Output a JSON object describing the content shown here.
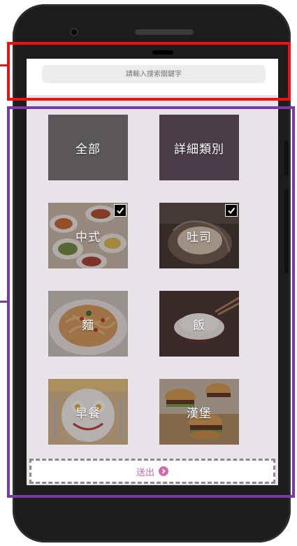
{
  "search": {
    "placeholder": "請輸入搜索關鍵字"
  },
  "categories": [
    {
      "label": "全部",
      "checked": false,
      "color": "#5a5759"
    },
    {
      "label": "詳細類別",
      "checked": false,
      "color": "#4a3d47"
    },
    {
      "label": "中式",
      "checked": true
    },
    {
      "label": "吐司",
      "checked": true
    },
    {
      "label": "麵",
      "checked": false
    },
    {
      "label": "飯",
      "checked": false
    },
    {
      "label": "早餐",
      "checked": false
    },
    {
      "label": "漢堡",
      "checked": false
    }
  ],
  "submit": {
    "label": "送出"
  },
  "colors": {
    "annotation_red": "#ee1111",
    "annotation_purple": "#7a3aa6",
    "accent_pink": "#d06aa8",
    "screen_bg": "#e8e3e8"
  }
}
